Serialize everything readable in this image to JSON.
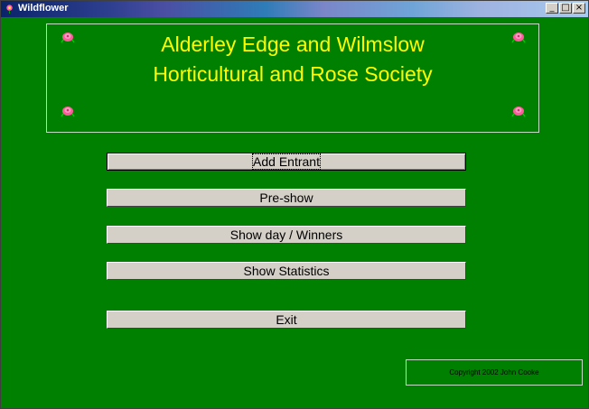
{
  "window": {
    "title": "Wildflower",
    "controls": {
      "minimize": "_",
      "maximize": "□",
      "close": "×"
    }
  },
  "banner": {
    "line1": "Alderley Edge and Wilmslow",
    "line2": "Horticultural and Rose Society",
    "decoration_icon": "rose-icon"
  },
  "menu": {
    "add_entrant": "Add Entrant",
    "pre_show": "Pre-show",
    "show_day": "Show day / Winners",
    "show_statistics": "Show Statistics",
    "exit": "Exit"
  },
  "footer": {
    "copyright": "Copyright 2002 John Cooke"
  },
  "colors": {
    "background": "#008000",
    "banner_text": "#ffff00",
    "button_face": "#d4d0c8"
  }
}
